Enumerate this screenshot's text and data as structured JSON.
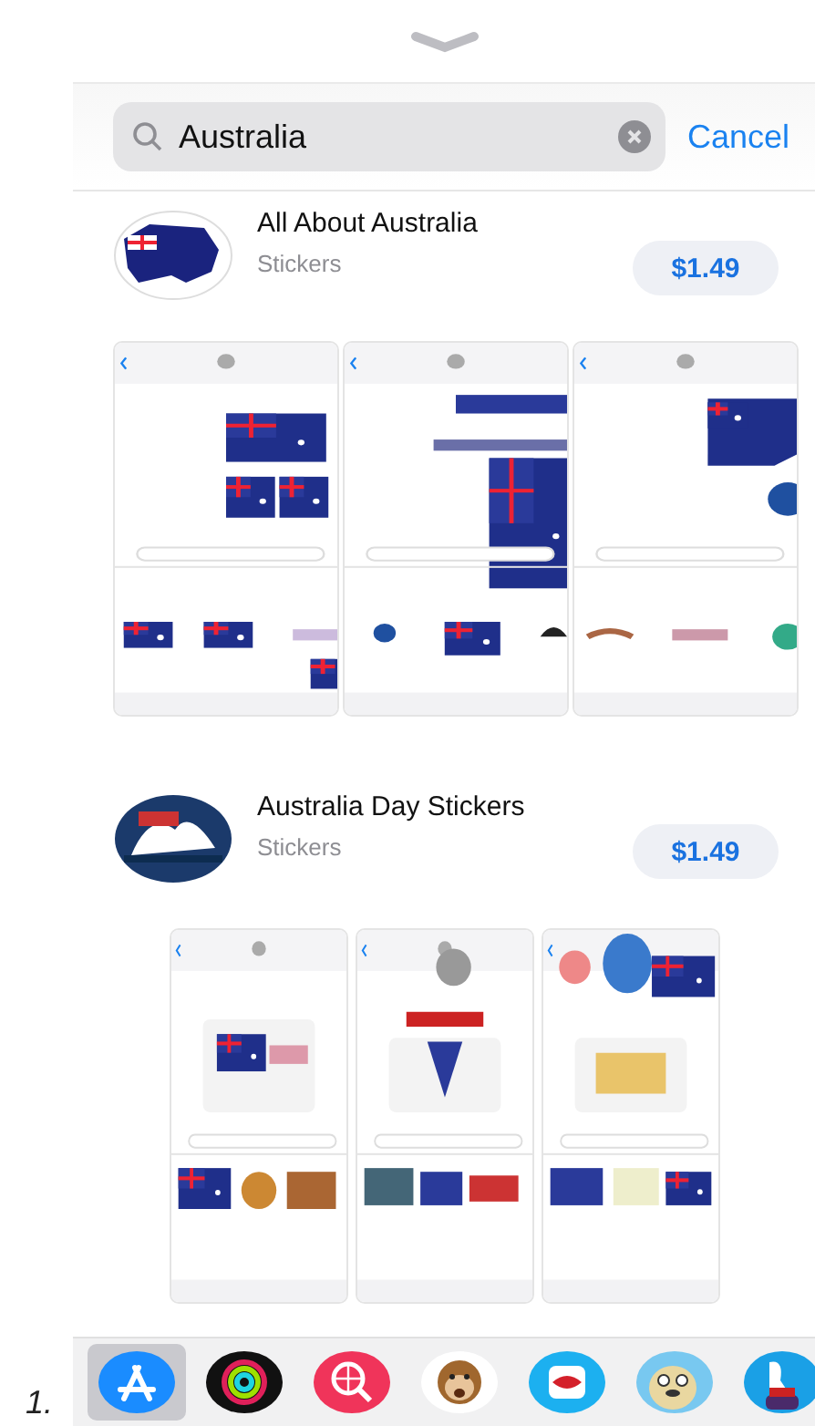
{
  "search": {
    "value": "Australia",
    "cancel": "Cancel"
  },
  "results": [
    {
      "title": "All About Australia",
      "category": "Stickers",
      "price": "$1.49",
      "kind": "wide",
      "icon": {
        "kind": "map"
      },
      "screenshots": [
        {
          "kind": "flags"
        },
        {
          "kind": "day"
        },
        {
          "kind": "map"
        }
      ]
    },
    {
      "title": "Australia Day Stickers",
      "category": "Stickers",
      "price": "$1.49",
      "kind": "narrow",
      "icon": {
        "kind": "opera"
      },
      "screenshots": [
        {
          "kind": "kangaroo"
        },
        {
          "kind": "koala"
        },
        {
          "kind": "balloons"
        }
      ]
    }
  ],
  "dock": [
    {
      "kind": "appstore",
      "selected": true
    },
    {
      "kind": "rings",
      "selected": false
    },
    {
      "kind": "globe",
      "selected": false
    },
    {
      "kind": "monkey",
      "selected": false
    },
    {
      "kind": "lips",
      "selected": false
    },
    {
      "kind": "pug",
      "selected": false
    },
    {
      "kind": "bird",
      "selected": false
    }
  ],
  "page_mark": "1."
}
